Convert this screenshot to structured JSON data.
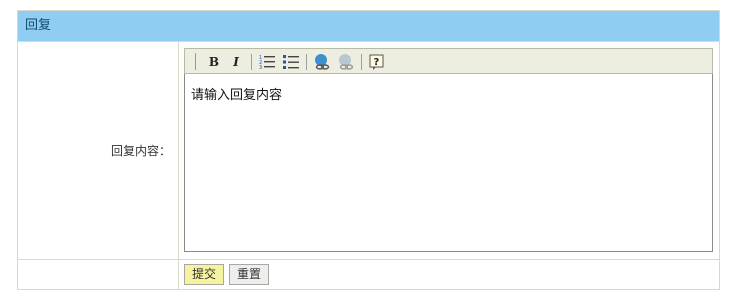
{
  "section": {
    "title": "回复"
  },
  "form": {
    "content_label": "回复内容：",
    "textarea_value": "请输入回复内容",
    "submit_label": "提交",
    "reset_label": "重置"
  },
  "toolbar": {
    "bold_label": "B",
    "italic_label": "I",
    "items": [
      "bold-icon",
      "italic-icon",
      "ordered-list-icon",
      "unordered-list-icon",
      "insert-link-icon",
      "remove-link-icon",
      "help-icon"
    ]
  },
  "colors": {
    "header_bg": "#8fcdf2",
    "submit_bg": "#f5f2a0",
    "toolbar_bg": "#eeeee0"
  }
}
